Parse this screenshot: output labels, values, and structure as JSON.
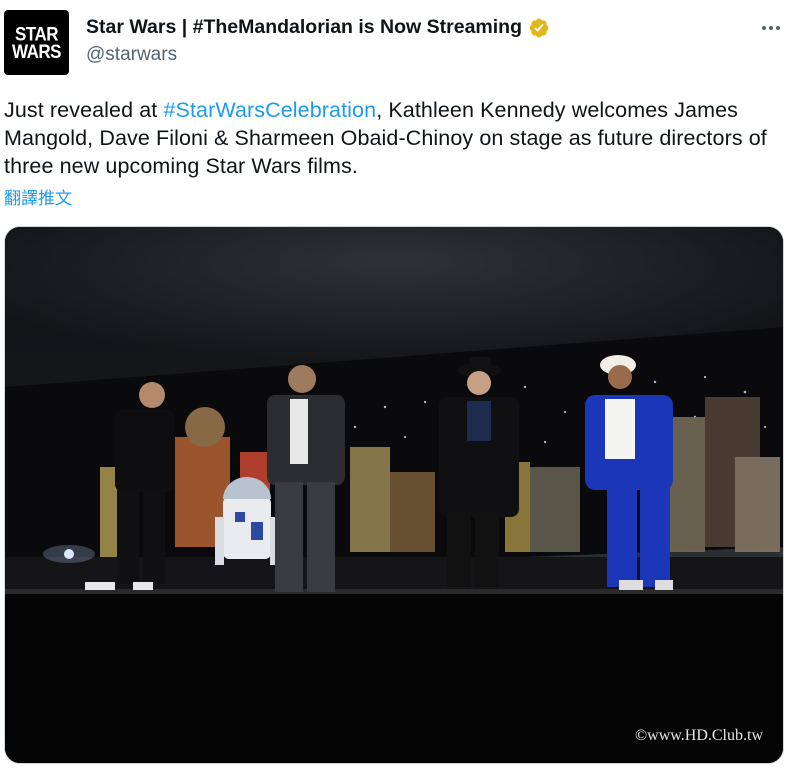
{
  "tweet": {
    "display_name": "Star Wars | #TheMandalorian is Now Streaming",
    "handle": "@starwars",
    "logo_lines": [
      "STAR",
      "WARS"
    ],
    "text_before": "Just revealed at ",
    "hashtag": "#StarWarsCelebration",
    "text_after": ", Kathleen Kennedy welcomes James Mangold, Dave Filoni & Sharmeen Obaid-Chinoy on stage as future directors of three new upcoming Star Wars films.",
    "translate_label": "翻譯推文",
    "more_icon": "more-horizontal-icon",
    "verified_icon": "verified-badge-icon"
  },
  "photo": {
    "watermark": "©www.HD.Club.tw"
  },
  "colors": {
    "text": "#0f1419",
    "secondary": "#536471",
    "link": "#1d9bf0",
    "verified_gold": "#e2b719"
  }
}
